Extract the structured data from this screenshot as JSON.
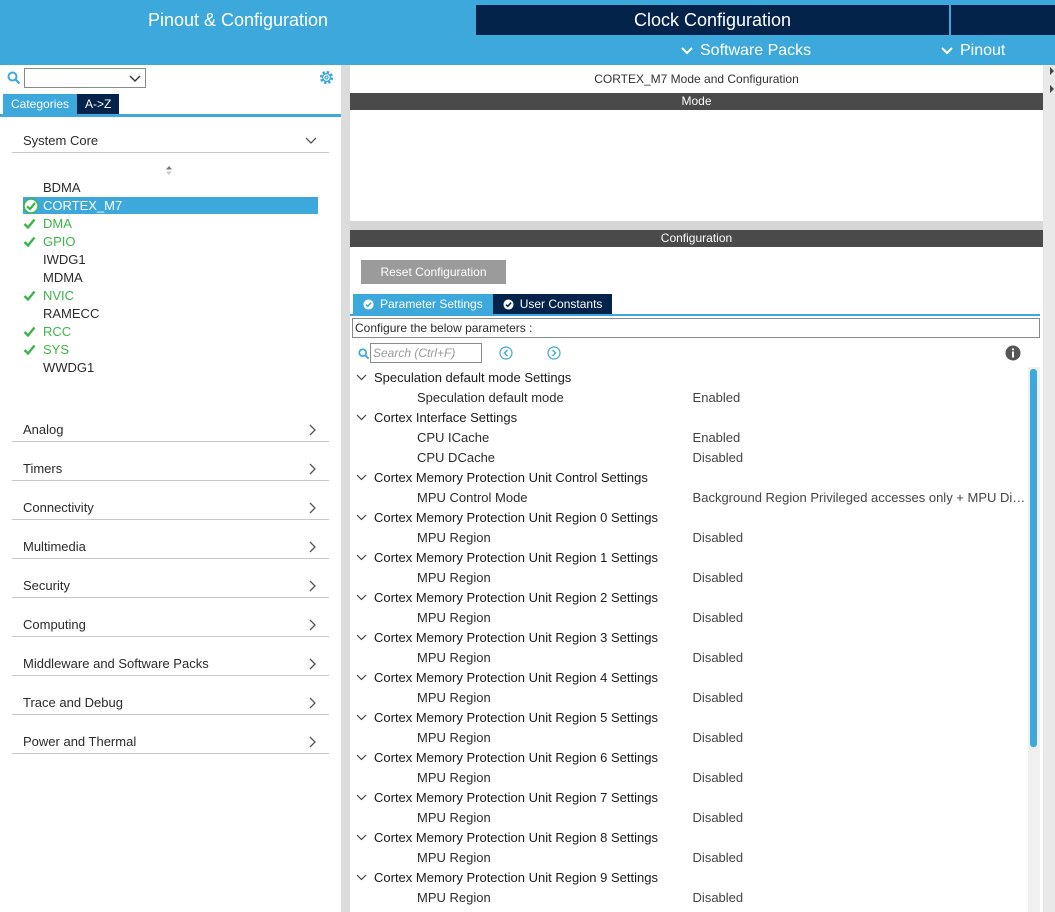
{
  "header": {
    "tabs": [
      {
        "label": "Pinout & Configuration"
      },
      {
        "label": "Clock Configuration"
      }
    ],
    "submenus": [
      {
        "label": "Software Packs"
      },
      {
        "label": "Pinout"
      }
    ]
  },
  "left": {
    "search": {
      "value": ""
    },
    "tabs": [
      {
        "label": "Categories"
      },
      {
        "label": "A->Z"
      }
    ],
    "system_core": {
      "label": "System Core",
      "items": [
        {
          "name": "BDMA",
          "state": "none"
        },
        {
          "name": "CORTEX_M7",
          "state": "selected"
        },
        {
          "name": "DMA",
          "state": "ok"
        },
        {
          "name": "GPIO",
          "state": "ok"
        },
        {
          "name": "IWDG1",
          "state": "none"
        },
        {
          "name": "MDMA",
          "state": "none"
        },
        {
          "name": "NVIC",
          "state": "ok"
        },
        {
          "name": "RAMECC",
          "state": "none"
        },
        {
          "name": "RCC",
          "state": "ok"
        },
        {
          "name": "SYS",
          "state": "ok"
        },
        {
          "name": "WWDG1",
          "state": "none"
        }
      ]
    },
    "categories": [
      {
        "label": "Analog"
      },
      {
        "label": "Timers"
      },
      {
        "label": "Connectivity"
      },
      {
        "label": "Multimedia"
      },
      {
        "label": "Security"
      },
      {
        "label": "Computing"
      },
      {
        "label": "Middleware and Software Packs"
      },
      {
        "label": "Trace and Debug"
      },
      {
        "label": "Power and Thermal"
      }
    ],
    "colors": {
      "ok": "#3bb54a",
      "selected": "#3ca8dc"
    }
  },
  "right": {
    "title": "CORTEX_M7 Mode and Configuration",
    "mode_label": "Mode",
    "config_label": "Configuration",
    "reset_label": "Reset Configuration",
    "tabs": [
      {
        "label": "Parameter Settings"
      },
      {
        "label": "User Constants"
      }
    ],
    "description": "Configure the below parameters :",
    "search_placeholder": "Search (Ctrl+F)",
    "groups": [
      {
        "title": "Speculation default mode Settings",
        "params": [
          {
            "name": "Speculation default mode",
            "value": "Enabled"
          }
        ]
      },
      {
        "title": "Cortex Interface Settings",
        "params": [
          {
            "name": "CPU ICache",
            "value": "Enabled"
          },
          {
            "name": "CPU DCache",
            "value": "Disabled"
          }
        ]
      },
      {
        "title": "Cortex Memory Protection Unit Control Settings",
        "params": [
          {
            "name": "MPU Control Mode",
            "value": "Background Region Privileged accesses only + MPU Disabled"
          }
        ]
      },
      {
        "title": "Cortex Memory Protection Unit Region 0 Settings",
        "params": [
          {
            "name": "MPU Region",
            "value": "Disabled"
          }
        ]
      },
      {
        "title": "Cortex Memory Protection Unit Region 1 Settings",
        "params": [
          {
            "name": "MPU Region",
            "value": "Disabled"
          }
        ]
      },
      {
        "title": "Cortex Memory Protection Unit Region 2 Settings",
        "params": [
          {
            "name": "MPU Region",
            "value": "Disabled"
          }
        ]
      },
      {
        "title": "Cortex Memory Protection Unit Region 3 Settings",
        "params": [
          {
            "name": "MPU Region",
            "value": "Disabled"
          }
        ]
      },
      {
        "title": "Cortex Memory Protection Unit Region 4 Settings",
        "params": [
          {
            "name": "MPU Region",
            "value": "Disabled"
          }
        ]
      },
      {
        "title": "Cortex Memory Protection Unit Region 5 Settings",
        "params": [
          {
            "name": "MPU Region",
            "value": "Disabled"
          }
        ]
      },
      {
        "title": "Cortex Memory Protection Unit Region 6 Settings",
        "params": [
          {
            "name": "MPU Region",
            "value": "Disabled"
          }
        ]
      },
      {
        "title": "Cortex Memory Protection Unit Region 7 Settings",
        "params": [
          {
            "name": "MPU Region",
            "value": "Disabled"
          }
        ]
      },
      {
        "title": "Cortex Memory Protection Unit Region 8 Settings",
        "params": [
          {
            "name": "MPU Region",
            "value": "Disabled"
          }
        ]
      },
      {
        "title": "Cortex Memory Protection Unit Region 9 Settings",
        "params": [
          {
            "name": "MPU Region",
            "value": "Disabled"
          }
        ]
      }
    ]
  },
  "icons": [
    "search-icon",
    "gear-icon",
    "chevron-down-icon",
    "chevron-right-icon",
    "check-icon",
    "info-icon",
    "prev-icon",
    "next-icon",
    "sort-icon"
  ]
}
